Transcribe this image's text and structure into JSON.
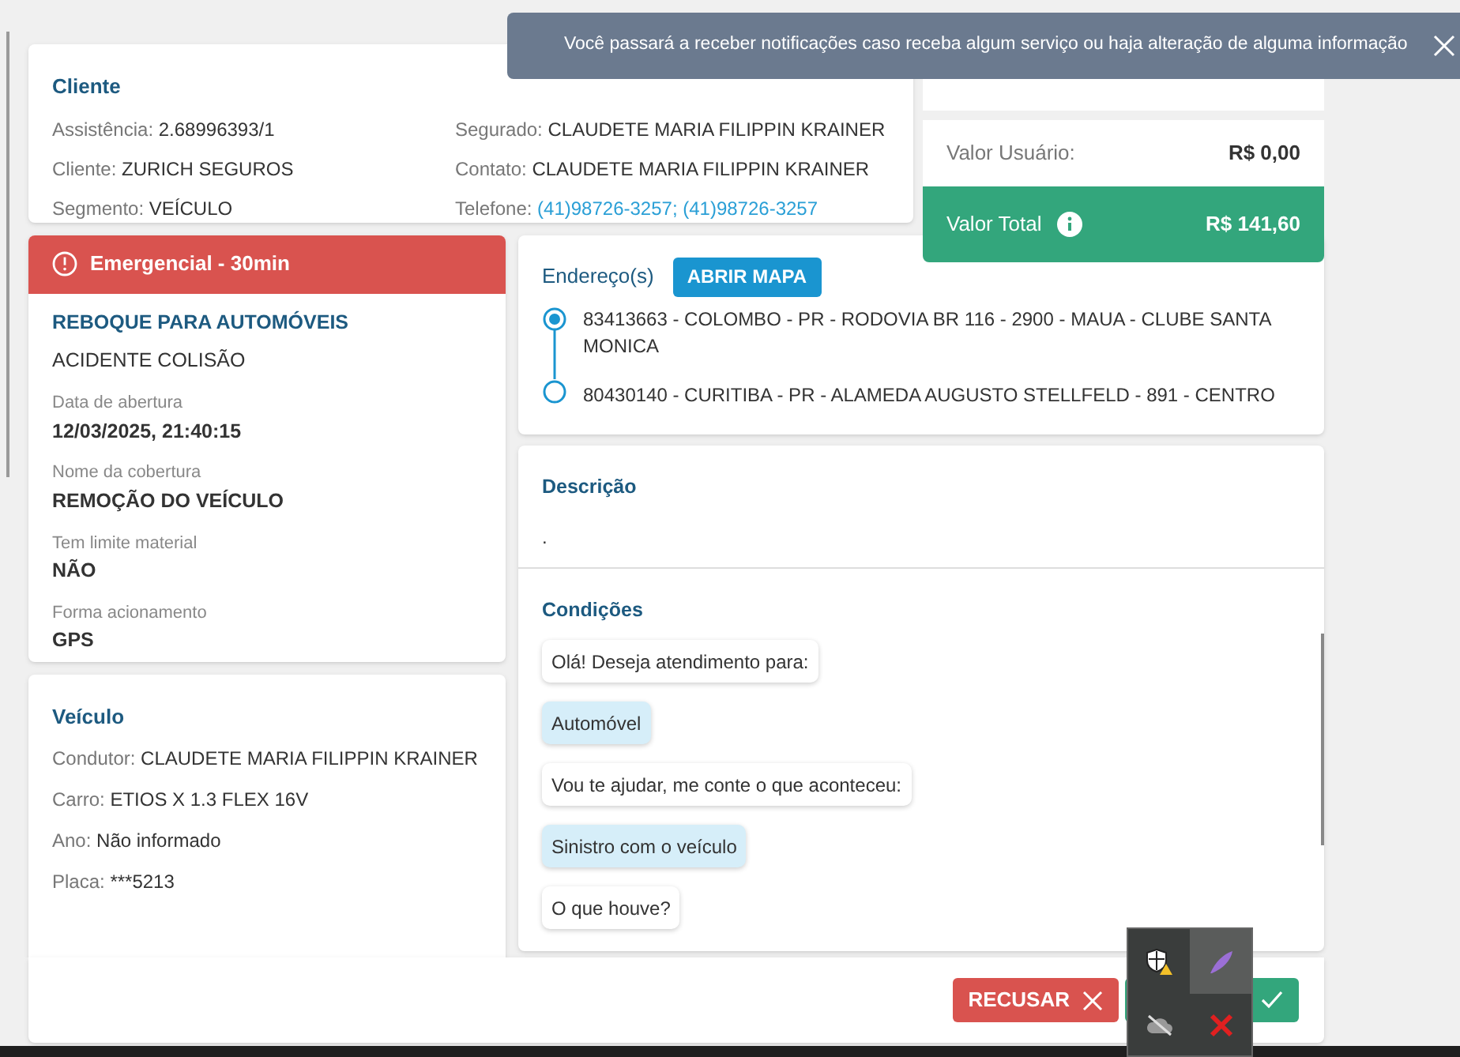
{
  "notification": {
    "message": "Você passará a receber notificações caso receba algum serviço ou haja alteração de alguma informação"
  },
  "client_card": {
    "title": "Cliente",
    "left_fields": [
      {
        "label": "Assistência:",
        "value": "2.68996393/1",
        "kind": "text"
      },
      {
        "label": "Cliente:",
        "value": "ZURICH SEGUROS",
        "kind": "text"
      },
      {
        "label": "Segmento:",
        "value": "VEÍCULO",
        "kind": "text"
      }
    ],
    "right_fields": [
      {
        "label": "Segurado:",
        "value": "CLAUDETE MARIA FILIPPIN KRAINER",
        "kind": "text"
      },
      {
        "label": "Contato:",
        "value": "CLAUDETE MARIA FILIPPIN KRAINER",
        "kind": "text"
      },
      {
        "label": "Telefone:",
        "value": "(41)98726-3257; (41)98726-3257",
        "kind": "link"
      }
    ]
  },
  "values": [
    {
      "label": "Valor Usuário:",
      "value": "R$ 0,00",
      "kind": "row"
    },
    {
      "label": "Valor Total",
      "value": "R$ 141,60",
      "kind": "total"
    }
  ],
  "service_card": {
    "badge": "Emergencial - 30min",
    "service": "REBOQUE PARA AUTOMÓVEIS",
    "reason": "ACIDENTE COLISÃO",
    "details": [
      {
        "label": "Data de abertura",
        "value": "12/03/2025, 21:40:15"
      },
      {
        "label": "Nome da cobertura",
        "value": "REMOÇÃO DO VEÍCULO"
      },
      {
        "label": "Tem limite material",
        "value": "NÃO"
      },
      {
        "label": "Forma acionamento",
        "value": "GPS"
      }
    ]
  },
  "address_card": {
    "title": "Endereço(s)",
    "map_button": "ABRIR MAPA",
    "addresses": [
      {
        "text": "83413663 - COLOMBO - PR - RODOVIA BR 116 - 2900 - MAUA - CLUBE SANTA MONICA",
        "kind": "origin"
      },
      {
        "text": "80430140 - CURITIBA - PR - ALAMEDA AUGUSTO STELLFELD - 891 - CENTRO",
        "kind": "destination"
      }
    ]
  },
  "vehicle_card": {
    "title": "Veículo",
    "fields": [
      {
        "label": "Condutor:",
        "value": "CLAUDETE MARIA FILIPPIN KRAINER",
        "kind": "text"
      },
      {
        "label": "Carro:",
        "value": "ETIOS X 1.3 FLEX 16V",
        "kind": "text"
      },
      {
        "label": "Ano:",
        "value": "Não informado",
        "kind": "text"
      },
      {
        "label": "Placa:",
        "value": "***5213",
        "kind": "text"
      }
    ]
  },
  "description": {
    "title": "Descrição",
    "text": "."
  },
  "conditions": {
    "title": "Condições",
    "messages": [
      {
        "text": "Olá! Deseja atendimento para:",
        "kind": "bot"
      },
      {
        "text": "Automóvel",
        "kind": "user"
      },
      {
        "text": "Vou te ajudar, me conte o que aconteceu:",
        "kind": "bot"
      },
      {
        "text": "Sinistro com o veículo",
        "kind": "user"
      },
      {
        "text": "O que houve?",
        "kind": "bot"
      }
    ]
  },
  "footer": {
    "refuse_button": "RECUSAR"
  }
}
